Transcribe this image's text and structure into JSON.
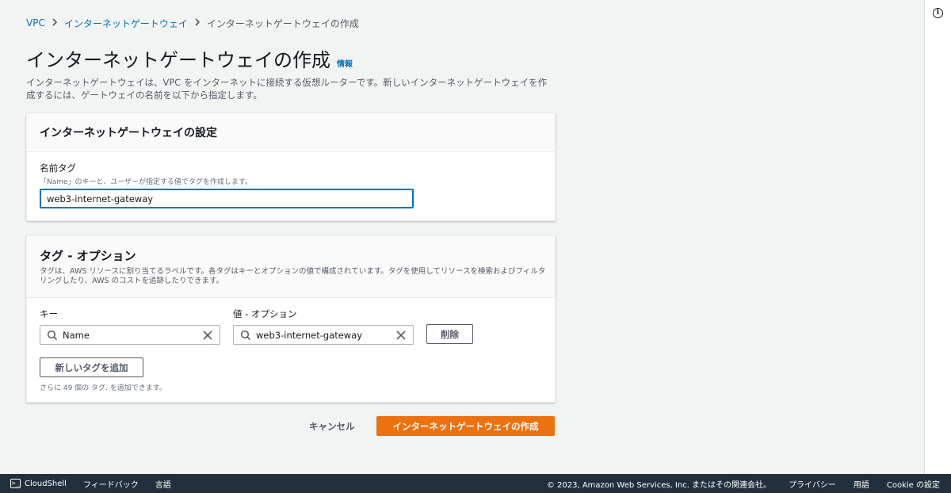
{
  "breadcrumb": {
    "items": [
      "VPC",
      "インターネットゲートウェイ"
    ],
    "current": "インターネットゲートウェイの作成"
  },
  "page": {
    "title": "インターネットゲートウェイの作成",
    "info_link": "情報",
    "description": "インターネットゲートウェイは、VPC をインターネットに接続する仮想ルーターです。新しいインターネットゲートウェイを作成するには、ゲートウェイの名前を以下から指定します。"
  },
  "settings_panel": {
    "title": "インターネットゲートウェイの設定",
    "name_label": "名前タグ",
    "name_hint": "「Name」のキーと、ユーザーが指定する値でタグを作成します。",
    "name_value": "web3-internet-gateway"
  },
  "tags_panel": {
    "title": "タグ - オプション",
    "description": "タグは、AWS リソースに割り当てるラベルです。各タグはキーとオプションの値で構成されています。タグを使用してリソースを検索およびフィルタリングしたり、AWS のコストを追跡したりできます。",
    "key_label": "キー",
    "value_label": "値 - オプション",
    "key_value": "Name",
    "value_value": "web3-internet-gateway",
    "remove_button": "削除",
    "add_button": "新しいタグを追加",
    "add_hint": "さらに 49 個の タグ. を追加できます。"
  },
  "actions": {
    "cancel": "キャンセル",
    "create": "インターネットゲートウェイの作成"
  },
  "footer": {
    "cloudshell_icon": ">_",
    "cloudshell": "CloudShell",
    "feedback": "フィードバック",
    "language": "言語",
    "copyright": "© 2023, Amazon Web Services, Inc. またはその関連会社。",
    "privacy": "プライバシー",
    "terms": "用語",
    "cookie": "Cookie の設定"
  },
  "icons": {
    "info": "info-circle-icon",
    "search": "search-icon",
    "clear": "close-icon",
    "breadcrumb_separator": "chevron-right-icon"
  },
  "colors": {
    "link": "#0073bb",
    "primary": "#ec7211",
    "footer_bg": "#232f3e",
    "page_bg": "#f2f3f3"
  }
}
